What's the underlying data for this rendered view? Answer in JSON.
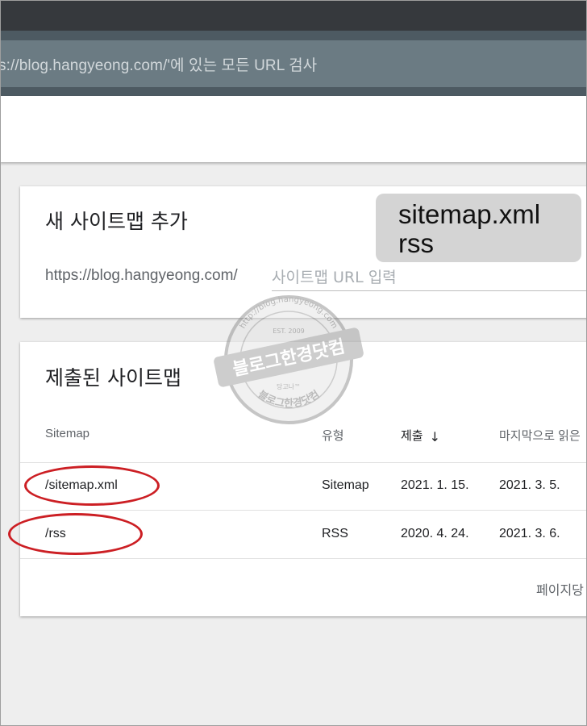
{
  "address_bar": {
    "text": "s://blog.hangyeong.com/'에 있는 모든 URL 검사"
  },
  "add_sitemap": {
    "title": "새 사이트맵 추가",
    "url_prefix": "https://blog.hangyeong.com/",
    "input_placeholder": "사이트맵 URL 입력",
    "callout_lines": [
      "sitemap.xml",
      "rss"
    ]
  },
  "submitted_sitemaps": {
    "title": "제출된 사이트맵",
    "columns": {
      "sitemap": "Sitemap",
      "type": "유형",
      "submitted": "제출",
      "last_read": "마지막으로 읽은"
    },
    "rows": [
      {
        "sitemap": "/sitemap.xml",
        "type": "Sitemap",
        "submitted": "2021. 1. 15.",
        "last_read": "2021. 3. 5."
      },
      {
        "sitemap": "/rss",
        "type": "RSS",
        "submitted": "2020. 4. 24.",
        "last_read": "2021. 3. 6."
      }
    ],
    "pagination_label": "페이지당"
  },
  "watermark": {
    "top_text": "http://blog.hangyeong.com",
    "est": "EST. 2009",
    "main": "블로그한경닷컴",
    "sub": "당고나™",
    "bottom_text": "블로그한경닷컴"
  },
  "colors": {
    "annotation_ellipse": "#cc1f24",
    "callout_bg": "#d4d4d4",
    "url_bar": "#6b7b83",
    "top_bar": "#36393d"
  },
  "icons": {
    "sort": "arrow-down-icon"
  }
}
